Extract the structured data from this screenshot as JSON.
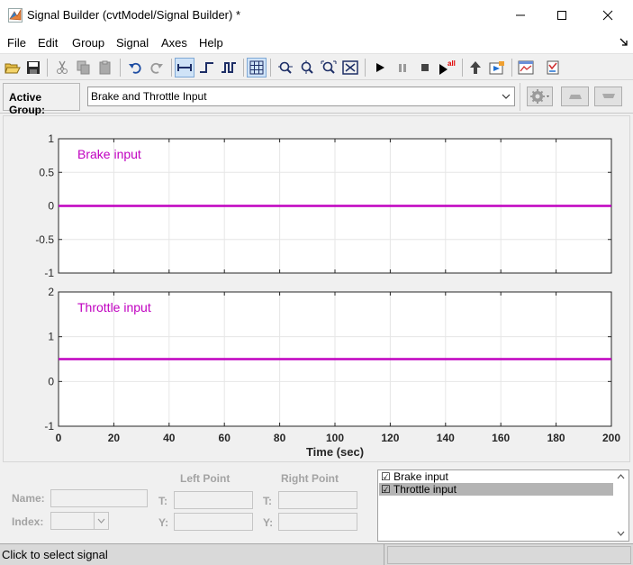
{
  "window": {
    "title": "Signal Builder (cvtModel/Signal Builder) *"
  },
  "menu": [
    "File",
    "Edit",
    "Group",
    "Signal",
    "Axes",
    "Help"
  ],
  "toolbar": {
    "icons": [
      "open-icon",
      "save-icon",
      "cut-icon",
      "copy-icon",
      "paste-icon",
      "undo-icon",
      "redo-icon",
      "constant-segment-icon",
      "step-icon",
      "pulse-icon",
      "grid-icon",
      "zoom-x-icon",
      "zoom-y-icon",
      "zoom-xy-icon",
      "fit-all-icon",
      "run-icon",
      "pause-icon",
      "stop-icon",
      "run-all-icon",
      "go-to-block-icon",
      "simulink-library-icon",
      "signal-editor-icon",
      "show-verification-icon"
    ],
    "run_all_badge": "all"
  },
  "group": {
    "label": "Active Group:",
    "selected": "Brake and Throttle Input"
  },
  "accent_color": "#c000c0",
  "chart_data": [
    {
      "type": "line",
      "title": "Brake input",
      "xlim": [
        0,
        200
      ],
      "ylim": [
        -1,
        1
      ],
      "yticks": [
        "1",
        "0.5",
        "0",
        "-0.5",
        "-1"
      ],
      "grid": true,
      "series": [
        {
          "name": "Brake input",
          "x": [
            0,
            200
          ],
          "y": [
            0,
            0
          ]
        }
      ]
    },
    {
      "type": "line",
      "title": "Throttle input",
      "xlim": [
        0,
        200
      ],
      "ylim": [
        -1,
        2
      ],
      "yticks": [
        "2",
        "1",
        "0",
        "-1"
      ],
      "xticks": [
        "0",
        "20",
        "40",
        "60",
        "80",
        "100",
        "120",
        "140",
        "160",
        "180",
        "200"
      ],
      "xlabel": "Time (sec)",
      "grid": true,
      "series": [
        {
          "name": "Throttle input",
          "x": [
            0,
            200
          ],
          "y": [
            0.5,
            0.5
          ]
        }
      ]
    }
  ],
  "point_editor": {
    "name_label": "Name:",
    "index_label": "Index:",
    "left_point": "Left Point",
    "right_point": "Right Point",
    "t_label": "T:",
    "y_label": "Y:"
  },
  "signal_list": [
    {
      "label": "☑ Brake input",
      "selected": false
    },
    {
      "label": "☑ Throttle input",
      "selected": true
    }
  ],
  "status": {
    "text": "Click to select signal"
  }
}
